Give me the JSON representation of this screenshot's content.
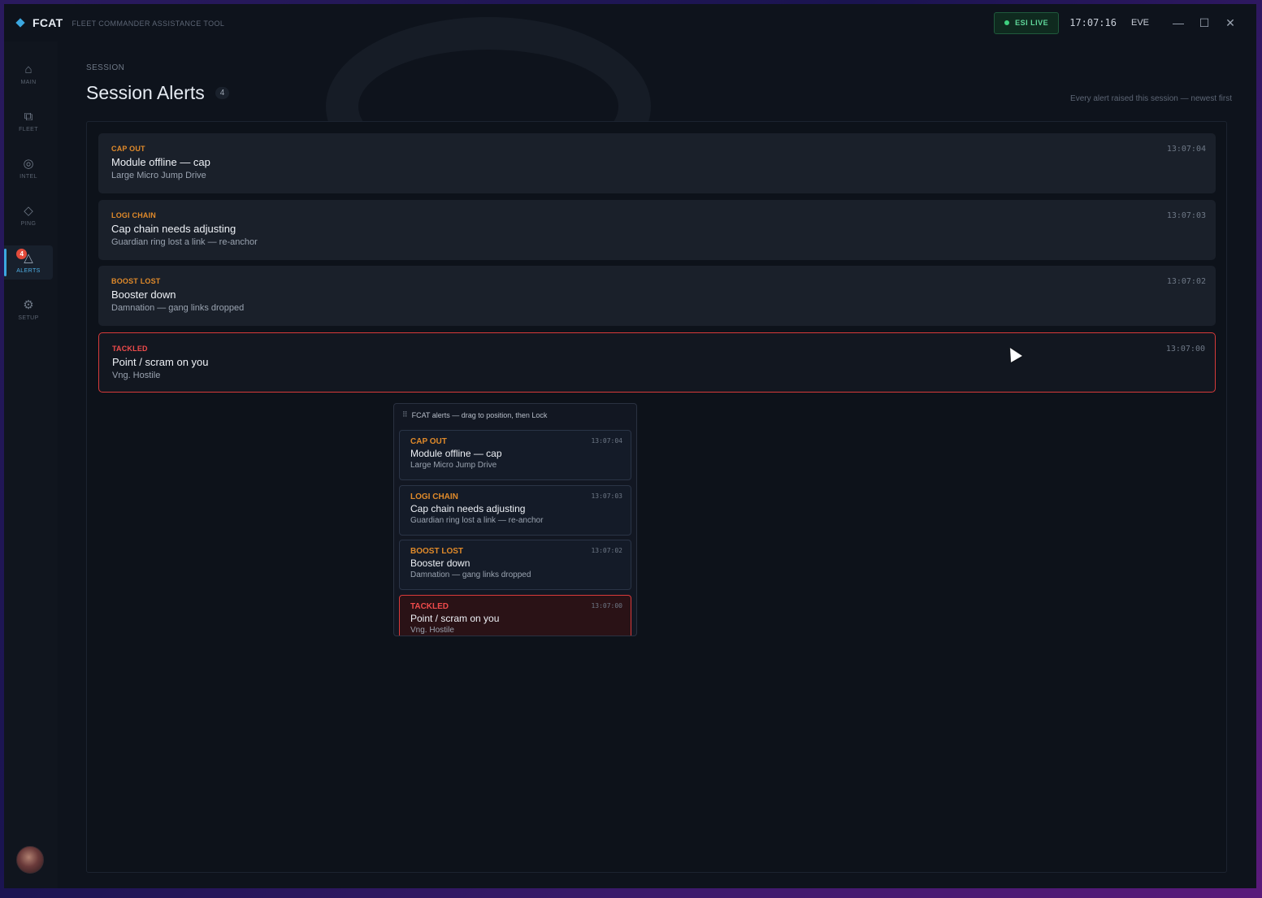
{
  "titlebar": {
    "app_name": "FCAT",
    "app_subtitle": "FLEET COMMANDER ASSISTANCE TOOL",
    "esi_status": "ESI LIVE",
    "clock": "17:07:16",
    "server": "EVE",
    "minimize_icon": "minimize-icon",
    "maximize_icon": "maximize-icon",
    "close_icon": "close-icon"
  },
  "sidebar": {
    "items": [
      {
        "label": "MAIN",
        "icon": "home-icon"
      },
      {
        "label": "FLEET",
        "icon": "fleet-icon"
      },
      {
        "label": "INTEL",
        "icon": "intel-icon"
      },
      {
        "label": "PING",
        "icon": "ping-icon"
      },
      {
        "label": "ALERTS",
        "icon": "alert-triangle-icon",
        "badge": "4",
        "active": true
      },
      {
        "label": "SETUP",
        "icon": "gear-icon"
      }
    ]
  },
  "page": {
    "breadcrumb": "SESSION",
    "title": "Session Alerts",
    "count": "4",
    "hint": "Every alert raised this session — newest first"
  },
  "alerts": [
    {
      "tag": "CAP OUT",
      "title": "Module offline — cap",
      "sub": "Large Micro Jump Drive",
      "time": "13:07:04",
      "severity": "warning"
    },
    {
      "tag": "LOGI CHAIN",
      "title": "Cap chain needs adjusting",
      "sub": "Guardian ring lost a link — re-anchor",
      "time": "13:07:03",
      "severity": "warning"
    },
    {
      "tag": "BOOST LOST",
      "title": "Booster down",
      "sub": "Damnation — gang links dropped",
      "time": "13:07:02",
      "severity": "warning"
    },
    {
      "tag": "TACKLED",
      "title": "Point / scram on you",
      "sub": "Vng. Hostile",
      "time": "13:07:00",
      "severity": "critical"
    }
  ],
  "overlay": {
    "header": "FCAT alerts — drag to position, then Lock"
  },
  "colors": {
    "accent": "#3ba7e0",
    "warning": "#e08a2a",
    "critical": "#ef4b4b",
    "live": "#3fd17f"
  }
}
